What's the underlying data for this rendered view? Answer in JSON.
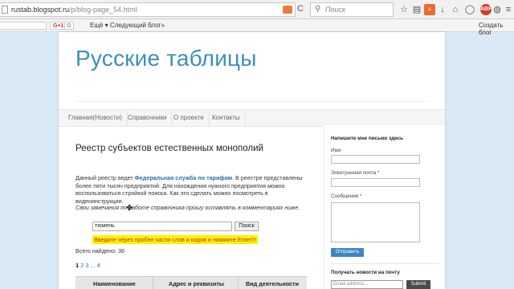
{
  "browser": {
    "url_host": "rustab.blogspot.ru",
    "url_path": "/p/blog-page_54.html",
    "search_placeholder": "Поиск",
    "reload_glyph": "C",
    "bookmark_glyph": "☆",
    "tb_icons": [
      "star-icon",
      "clipboard-icon",
      "gplus-icon",
      "download-icon",
      "home-icon",
      "chat-icon",
      "abp-icon",
      "globe-icon",
      "menu-icon"
    ]
  },
  "toolbar2": {
    "gplus_label": "G+1",
    "gplus_count": "0",
    "more_label": "Ещё ▾",
    "next_blog_label": "Следующий блог»",
    "create_blog_label": "Создать блог"
  },
  "blog": {
    "title": "Русские таблицы"
  },
  "nav": {
    "items": [
      "Главная(Новости)",
      "Справочники",
      "О проекте",
      "Контакты"
    ]
  },
  "post": {
    "title": "Реестр субъектов естественных монополий",
    "intro_before": "Данный реестр ведет ",
    "intro_link": "Федеральная служба по тарифам",
    "intro_after": ". В реестре представлены более пяти тысяч предприятий. Для нахождения нужного предприятия можно воспользоваться стройкой поиска. Как это сделать можно посмотреть в видеоинструкции.",
    "comment_note": "Свои замечания по работе справочника прошу оставлять в комментариях ниже.",
    "search_value": "тюмень",
    "search_button": "Поиск",
    "hint": "Введите через пробел части слов и кодов и нажмите Enter!!!",
    "found": "Всего найдено: 36",
    "pager_current": "1",
    "pager_pages": [
      "2",
      "3",
      "...",
      "4"
    ],
    "table_headers": [
      "Наименование",
      "Адрес и реквизиты",
      "Вид деятельности"
    ]
  },
  "sidebar": {
    "contact_heading": "Напишите мне письмо здесь",
    "name_label": "Имя",
    "email_label": "Электронная почта *",
    "message_label": "Сообщение *",
    "send_button": "Отправить",
    "subscribe_heading": "Получать новости на почту",
    "email_placeholder": "Email address...",
    "submit_button": "Submit"
  },
  "colors": {
    "title_blue": "#3d8fb8",
    "link_blue": "#2a6fa8",
    "hint_bg": "#f6f600",
    "hint_text": "#dd2222",
    "send_button_bg": "#3d85c6",
    "page_bg": "#dbe9f4"
  }
}
